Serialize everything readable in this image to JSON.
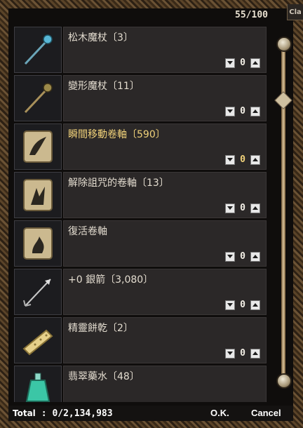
{
  "header": {
    "capacity": "55/100",
    "close_tab": "Cla"
  },
  "items": [
    {
      "name": "松木魔杖〔3〕",
      "qty": "0",
      "icon": "wand-icon",
      "highlight": false
    },
    {
      "name": "變形魔杖〔11〕",
      "qty": "0",
      "icon": "wand-icon",
      "highlight": false
    },
    {
      "name": "瞬間移動卷軸〔590〕",
      "qty": "0",
      "icon": "scroll-icon",
      "highlight": true
    },
    {
      "name": "解除詛咒的卷軸〔13〕",
      "qty": "0",
      "icon": "scroll-icon",
      "highlight": false
    },
    {
      "name": "復活卷軸",
      "qty": "0",
      "icon": "scroll-icon",
      "highlight": false
    },
    {
      "name": "+0 銀箭〔3,080〕",
      "qty": "0",
      "icon": "arrow-icon",
      "highlight": false
    },
    {
      "name": "精靈餅乾〔2〕",
      "qty": "0",
      "icon": "cookie-icon",
      "highlight": false
    },
    {
      "name": "翡翠藥水〔48〕",
      "qty": "0",
      "icon": "potion-icon",
      "highlight": false
    }
  ],
  "footer": {
    "total_label": "Total",
    "total_value": ": 0/2,134,983",
    "ok_label": "O.K.",
    "cancel_label": "Cancel"
  },
  "colors": {
    "highlight": "#f1d27a",
    "text": "#e3dccf"
  }
}
